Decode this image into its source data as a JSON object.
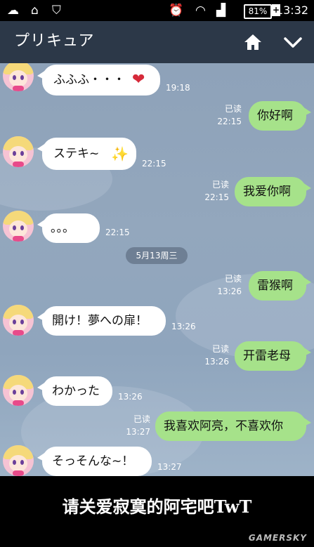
{
  "status_bar": {
    "cloud_icon": "cloud-icon",
    "time": "13:32",
    "battery": "81%",
    "charging_symbol": "+"
  },
  "header": {
    "title": "プリキュア",
    "home_icon": "home-icon",
    "dropdown_icon": "chevron-down-icon"
  },
  "chat": {
    "date_separator": "5月13周三",
    "messages": [
      {
        "side": "in",
        "text": "ふふふ・・・",
        "emoji": "❤",
        "time": "19:18"
      },
      {
        "side": "out",
        "text": "你好啊",
        "read": "已读",
        "time": "22:15"
      },
      {
        "side": "in",
        "text": "ステキ~",
        "emoji": "✨",
        "time": "22:15"
      },
      {
        "side": "out",
        "text": "我爱你啊",
        "read": "已读",
        "time": "22:15"
      },
      {
        "side": "in",
        "text": "。。。",
        "time": "22:15"
      },
      {
        "side": "out",
        "text": "雷猴啊",
        "read": "已读",
        "time": "13:26"
      },
      {
        "side": "in",
        "text": "開け！夢への扉！",
        "time": "13:26"
      },
      {
        "side": "out",
        "text": "开雷老母",
        "read": "已读",
        "time": "13:26"
      },
      {
        "side": "in",
        "text": "わかった",
        "time": "13:26"
      },
      {
        "side": "out",
        "text": "我喜欢阿亮，不喜欢你",
        "read": "已读",
        "time": "13:27"
      },
      {
        "side": "in",
        "text": "そっそんな~！",
        "time": "13:27"
      }
    ]
  },
  "caption": {
    "text": "请关爱寂寞的阿宅吧TwT",
    "watermark": "GAMERSKY"
  }
}
